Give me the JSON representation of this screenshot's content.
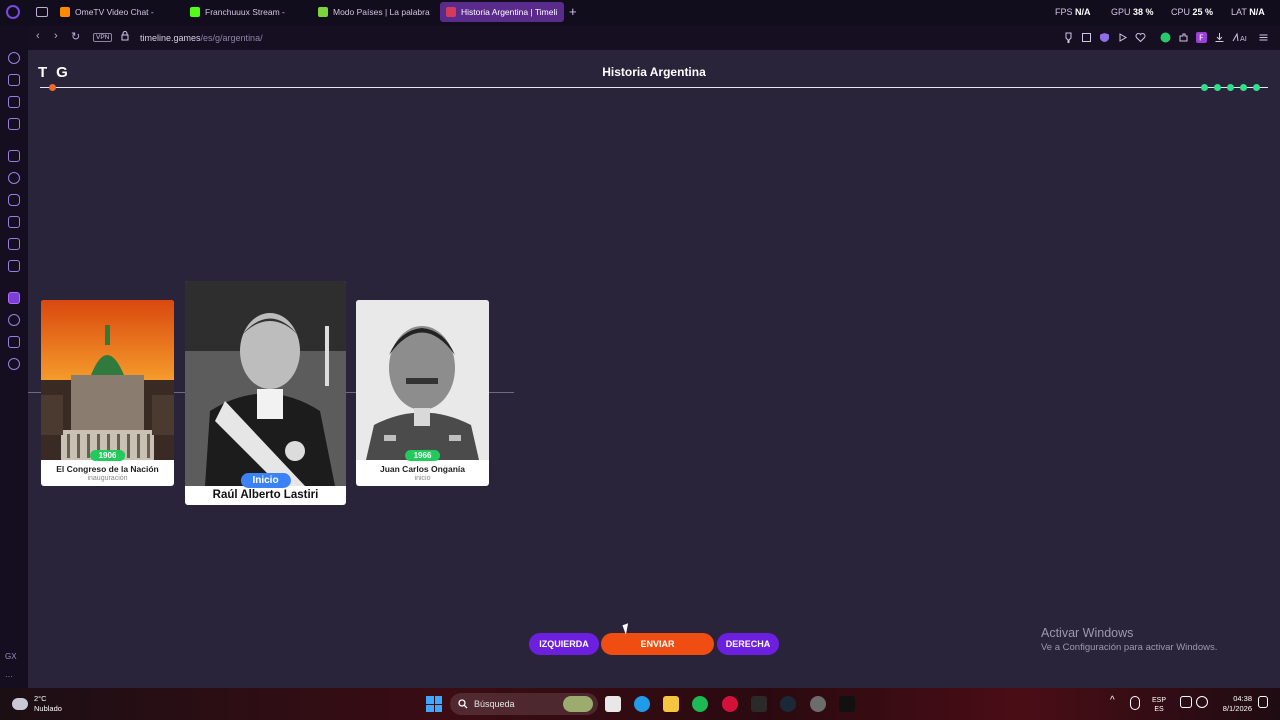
{
  "browser": {
    "tabs": [
      {
        "label": "OmeTV Video Chat -",
        "icon_color": "#ff8a00"
      },
      {
        "label": "Franchuuux Stream -",
        "icon_color": "#53fc18"
      },
      {
        "label": "Modo Países | La palabra",
        "icon_color": "#7cd33b"
      },
      {
        "label": "Historia Argentina | Timeli",
        "icon_color": "#d43b5a",
        "active": true
      }
    ],
    "new_tab": "+",
    "stats": {
      "fps_label": "FPS",
      "fps_value": "N/A",
      "gpu_label": "GPU",
      "gpu_value": "38 %",
      "cpu_label": "CPU",
      "cpu_value": "25 %",
      "lat_label": "LAT",
      "lat_value": "N/A"
    },
    "vpn": "VPN",
    "url_host": "timeline.games",
    "url_path": "/es/g/argentina/"
  },
  "sidebar": {
    "gx_label": "GX",
    "more_label": "···"
  },
  "game": {
    "brand": "TG",
    "title": "Historia Argentina",
    "lives_count": 5,
    "cards": [
      {
        "year": "1906",
        "name": "El Congreso de la Nación",
        "event": "inauguración"
      },
      {
        "year": "1966",
        "name": "Juan Carlos Onganía",
        "event": "inicio"
      }
    ],
    "current_card": {
      "badge": "Inicio",
      "name": "Raúl Alberto Lastiri"
    },
    "buttons": {
      "left": "IZQUIERDA",
      "send": "ENVIAR",
      "right": "DERECHA"
    }
  },
  "watermark": {
    "line1": "Activar Windows",
    "line2": "Ve a Configuración para activar Windows."
  },
  "taskbar": {
    "weather_temp": "2°C",
    "weather_desc": "Nublado",
    "search_placeholder": "Búsqueda",
    "lang_top": "ESP",
    "lang_bottom": "ES",
    "time": "04:38",
    "date": "8/1/2026"
  }
}
